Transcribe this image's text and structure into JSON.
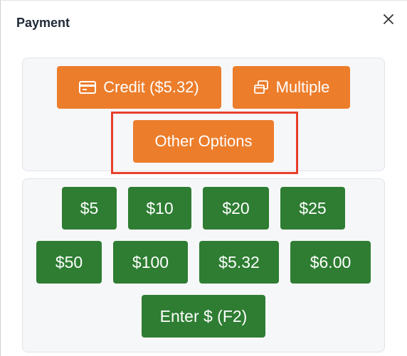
{
  "dialog": {
    "title": "Payment",
    "close_icon": "close-icon"
  },
  "payment_methods": {
    "credit_label": "Credit ($5.32)",
    "credit_icon": "credit-card-icon",
    "multiple_label": "Multiple",
    "multiple_icon": "windows-icon",
    "other_options_label": "Other Options"
  },
  "cash_amounts": {
    "row1": [
      "$5",
      "$10",
      "$20",
      "$25"
    ],
    "row2": [
      "$50",
      "$100",
      "$5.32",
      "$6.00"
    ],
    "enter_label": "Enter $ (F2)"
  },
  "colors": {
    "orange": "#ec7d2b",
    "green": "#2e7d32",
    "highlight": "#e8402c"
  }
}
